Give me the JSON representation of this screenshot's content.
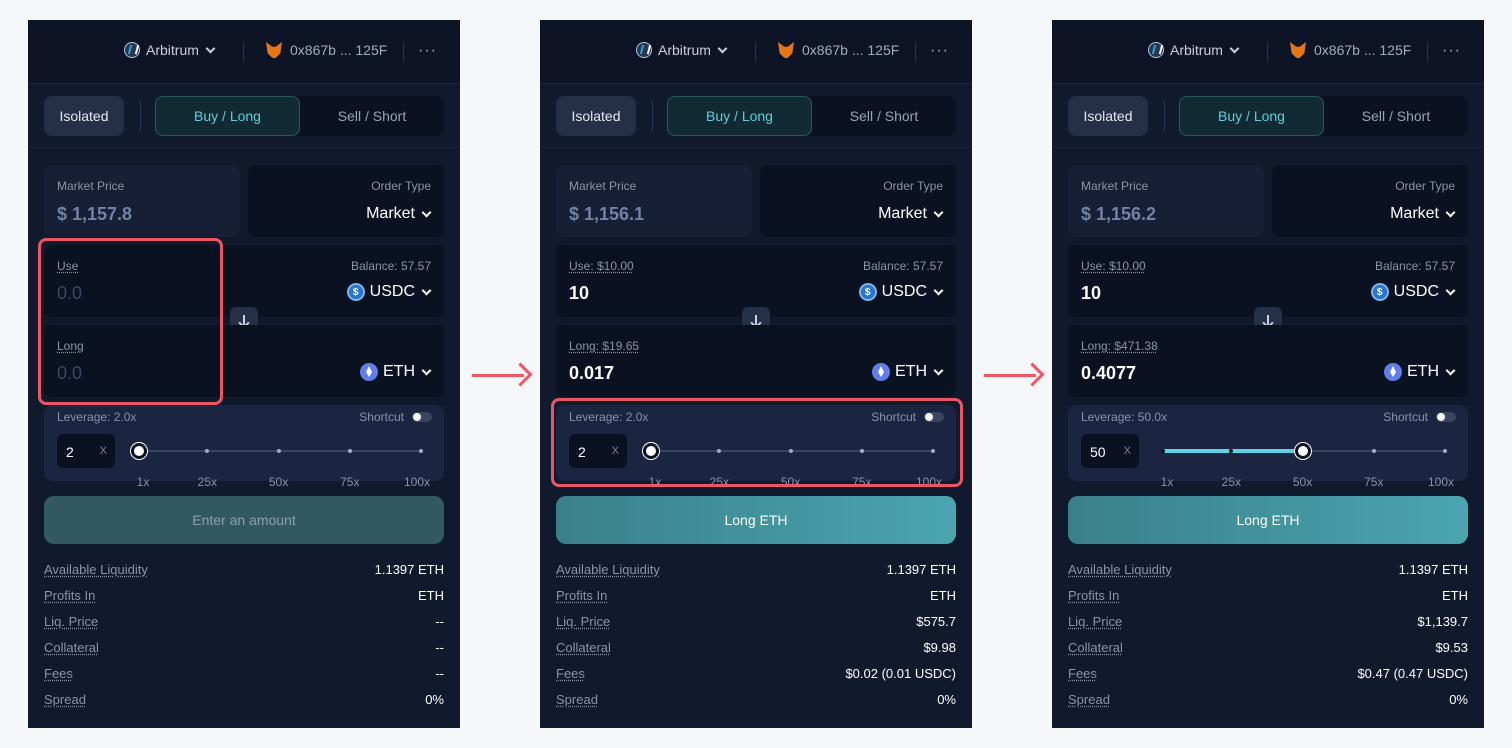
{
  "panels": [
    {
      "network": "Arbitrum",
      "wallet": "0x867b ... 125F",
      "more": "···",
      "mode": "Isolated",
      "tabs": {
        "buy": "Buy / Long",
        "sell": "Sell / Short"
      },
      "market_price_label": "Market Price",
      "market_price": "$ 1,157.8",
      "order_type_label": "Order Type",
      "order_type": "Market",
      "use_label": "Use",
      "balance": "Balance: 57.57",
      "use_amount": "0.0",
      "use_token": "USDC",
      "long_label": "Long",
      "long_amount": "0.0",
      "long_token": "ETH",
      "leverage_label": "Leverage: 2.0x",
      "shortcut_label": "Shortcut",
      "leverage_value": "2",
      "leverage_x": "X",
      "leverage_level": 1,
      "leverage_marks": [
        "1x",
        "25x",
        "50x",
        "75x",
        "100x"
      ],
      "cta": "Enter an amount",
      "stats": [
        {
          "k": "Available Liquidity",
          "v": "1.1397 ETH"
        },
        {
          "k": "Profits In",
          "v": "ETH"
        },
        {
          "k": "Liq. Price",
          "v": "--"
        },
        {
          "k": "Collateral",
          "v": "--"
        },
        {
          "k": "Fees",
          "v": "--"
        },
        {
          "k": "Spread",
          "v": "0%"
        }
      ]
    },
    {
      "network": "Arbitrum",
      "wallet": "0x867b ... 125F",
      "more": "···",
      "mode": "Isolated",
      "tabs": {
        "buy": "Buy / Long",
        "sell": "Sell / Short"
      },
      "market_price_label": "Market Price",
      "market_price": "$ 1,156.1",
      "order_type_label": "Order Type",
      "order_type": "Market",
      "use_label": "Use: $10.00",
      "balance": "Balance: 57.57",
      "use_amount": "10",
      "use_token": "USDC",
      "long_label": "Long: $19.65",
      "long_amount": "0.017",
      "long_token": "ETH",
      "leverage_label": "Leverage: 2.0x",
      "shortcut_label": "Shortcut",
      "leverage_value": "2",
      "leverage_x": "X",
      "leverage_level": 1,
      "leverage_marks": [
        "1x",
        "25x",
        "50x",
        "75x",
        "100x"
      ],
      "cta": "Long ETH",
      "stats": [
        {
          "k": "Available Liquidity",
          "v": "1.1397 ETH"
        },
        {
          "k": "Profits In",
          "v": "ETH"
        },
        {
          "k": "Liq. Price",
          "v": "$575.7"
        },
        {
          "k": "Collateral",
          "v": "$9.98"
        },
        {
          "k": "Fees",
          "v": "$0.02 (0.01 USDC)"
        },
        {
          "k": "Spread",
          "v": "0%"
        }
      ]
    },
    {
      "network": "Arbitrum",
      "wallet": "0x867b ... 125F",
      "more": "···",
      "mode": "Isolated",
      "tabs": {
        "buy": "Buy / Long",
        "sell": "Sell / Short"
      },
      "market_price_label": "Market Price",
      "market_price": "$ 1,156.2",
      "order_type_label": "Order Type",
      "order_type": "Market",
      "use_label": "Use: $10.00",
      "balance": "Balance: 57.57",
      "use_amount": "10",
      "use_token": "USDC",
      "long_label": "Long: $471.38",
      "long_amount": "0.4077",
      "long_token": "ETH",
      "leverage_label": "Leverage: 50.0x",
      "shortcut_label": "Shortcut",
      "leverage_value": "50",
      "leverage_x": "X",
      "leverage_level": 50,
      "leverage_marks": [
        "1x",
        "25x",
        "50x",
        "75x",
        "100x"
      ],
      "cta": "Long ETH",
      "stats": [
        {
          "k": "Available Liquidity",
          "v": "1.1397 ETH"
        },
        {
          "k": "Profits In",
          "v": "ETH"
        },
        {
          "k": "Liq. Price",
          "v": "$1,139.7"
        },
        {
          "k": "Collateral",
          "v": "$9.53"
        },
        {
          "k": "Fees",
          "v": "$0.47 (0.47 USDC)"
        },
        {
          "k": "Spread",
          "v": "0%"
        }
      ]
    }
  ],
  "colors": {
    "panel_bg": "#111a2d",
    "accent": "#5fd0dc",
    "highlight": "#ec5563",
    "cta_active": "#4aa5b1"
  },
  "icons": {
    "network": "arbitrum-icon",
    "wallet": "metamask-fox-icon",
    "usdc": "usdc-icon",
    "eth": "eth-icon",
    "swap": "arrow-down-icon",
    "flow": "arrow-right-icon"
  }
}
